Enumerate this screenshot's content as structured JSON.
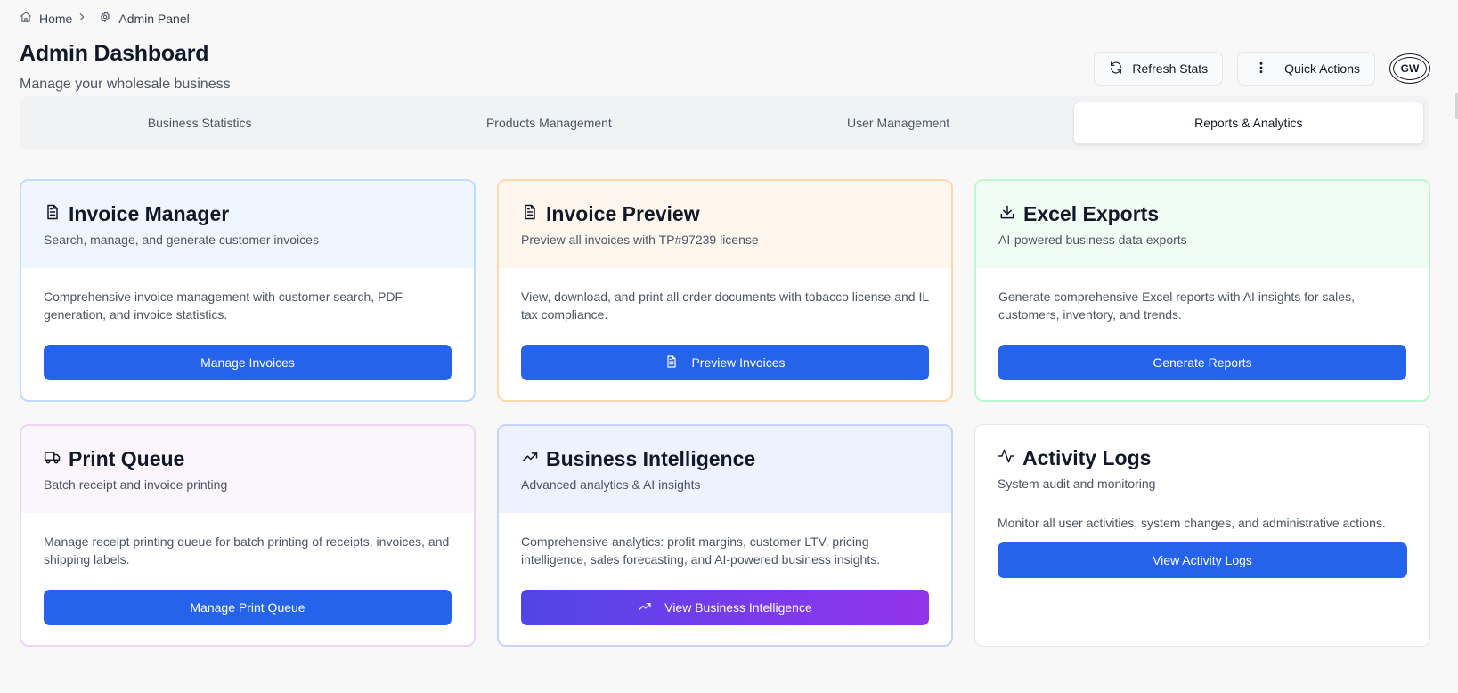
{
  "breadcrumb": {
    "home": "Home",
    "admin": "Admin Panel"
  },
  "header": {
    "title": "Admin Dashboard",
    "subtitle": "Manage your wholesale business",
    "refresh_label": "Refresh Stats",
    "quick_actions_label": "Quick Actions",
    "avatar_initials": "GW"
  },
  "tabs": [
    {
      "label": "Business Statistics",
      "active": false
    },
    {
      "label": "Products Management",
      "active": false
    },
    {
      "label": "User Management",
      "active": false
    },
    {
      "label": "Reports & Analytics",
      "active": true
    }
  ],
  "cards": [
    {
      "title": "Invoice Manager",
      "subtitle": "Search, manage, and generate customer invoices",
      "description": "Comprehensive invoice management with customer search, PDF generation, and invoice statistics.",
      "button": "Manage Invoices",
      "icon": "file-text-icon",
      "accent": "#eff6ff"
    },
    {
      "title": "Invoice Preview",
      "subtitle": "Preview all invoices with TP#97239 license",
      "description": "View, download, and print all order documents with tobacco license and IL tax compliance.",
      "button": "Preview Invoices",
      "icon": "file-text-icon",
      "accent": "#fff7ed"
    },
    {
      "title": "Excel Exports",
      "subtitle": "AI-powered business data exports",
      "description": "Generate comprehensive Excel reports with AI insights for sales, customers, inventory, and trends.",
      "button": "Generate Reports",
      "icon": "download-icon",
      "accent": "#f0fdf4"
    },
    {
      "title": "Print Queue",
      "subtitle": "Batch receipt and invoice printing",
      "description": "Manage receipt printing queue for batch printing of receipts, invoices, and shipping labels.",
      "button": "Manage Print Queue",
      "icon": "truck-icon",
      "accent": "#fbf5fe"
    },
    {
      "title": "Business Intelligence",
      "subtitle": "Advanced analytics & AI insights",
      "description": "Comprehensive analytics: profit margins, customer LTV, pricing intelligence, sales forecasting, and AI-powered business insights.",
      "button": "View Business Intelligence",
      "icon": "trending-up-icon",
      "accent": "#eef2ff"
    },
    {
      "title": "Activity Logs",
      "subtitle": "System audit and monitoring",
      "description": "Monitor all user activities, system changes, and administrative actions.",
      "button": "View Activity Logs",
      "icon": "activity-icon",
      "accent": "#ffffff"
    }
  ],
  "colors": {
    "primary_button": "#2563eb",
    "gradient_start": "#4f46e5",
    "gradient_end": "#9333ea",
    "page_bg": "#f8f8f8"
  }
}
